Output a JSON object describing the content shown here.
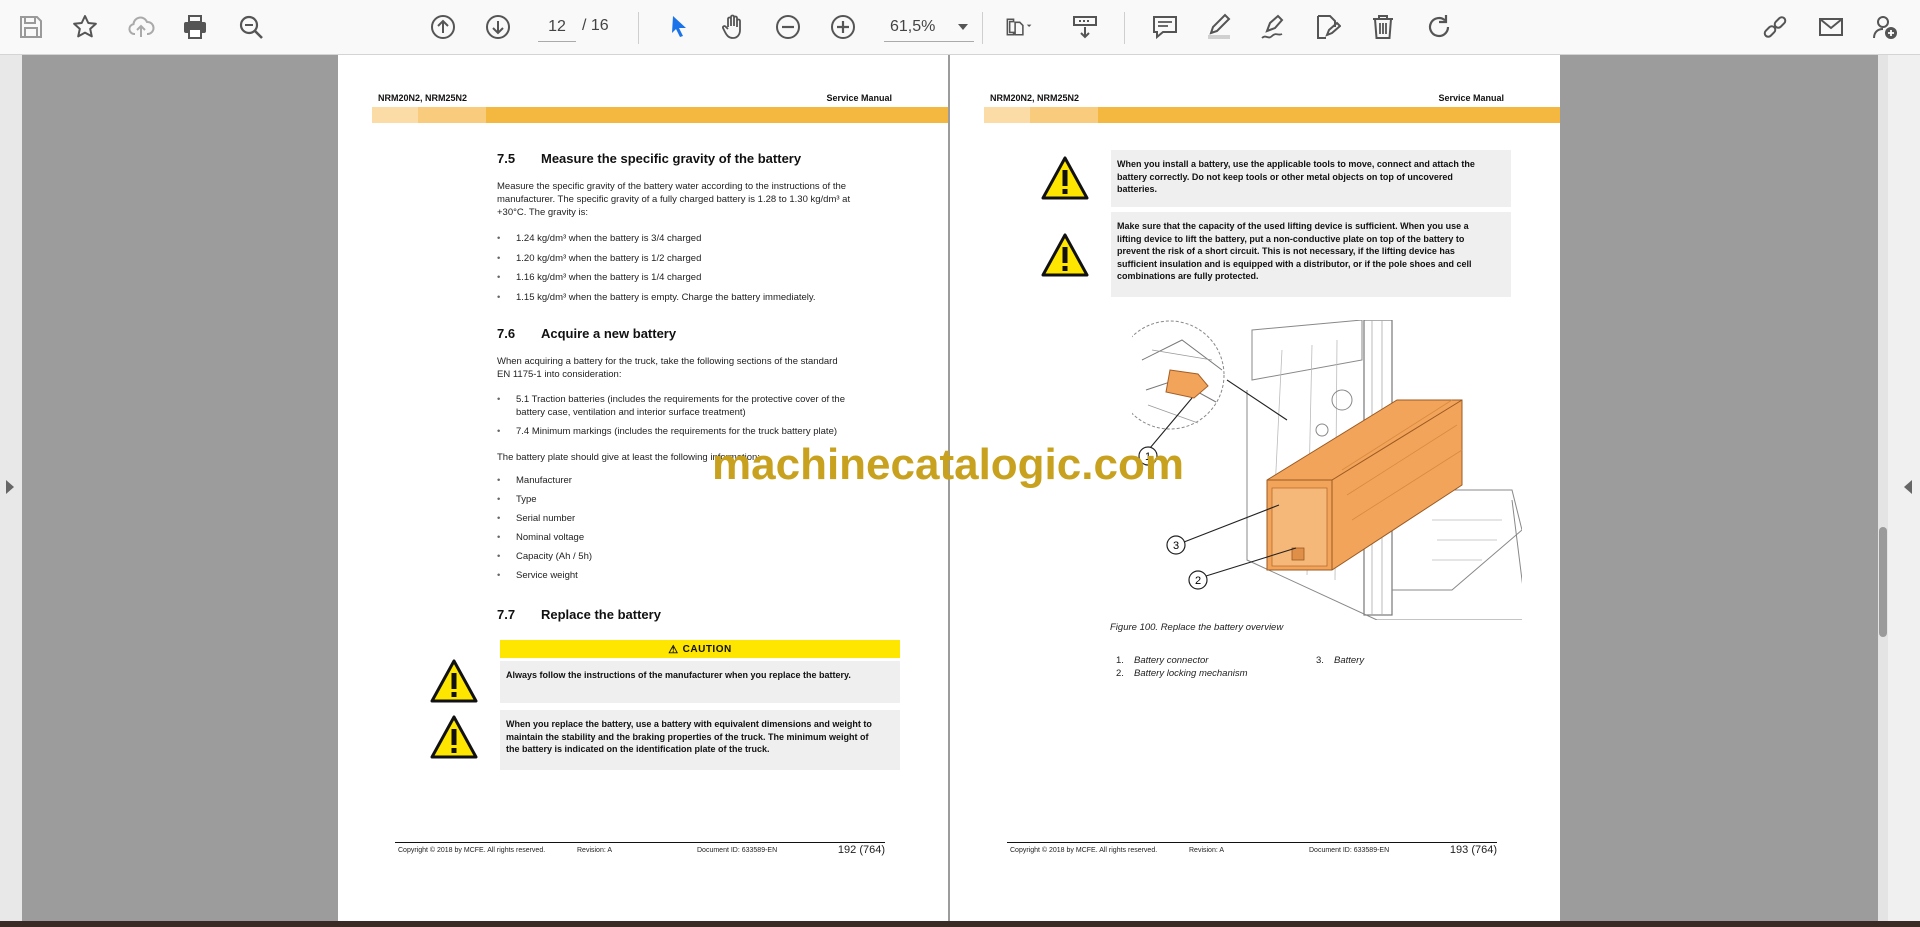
{
  "toolbar": {
    "page_current": "12",
    "page_total": "/ 16",
    "zoom": "61,5%"
  },
  "pages": {
    "left": {
      "header_left": "NRM20N2, NRM25N2",
      "header_right": "Service Manual",
      "sec75_num": "7.5",
      "sec75_title": "Measure the specific gravity of the battery",
      "sec75_para1": "Measure the specific gravity of the battery water according to the instructions of the",
      "sec75_para2": "manufacturer. The specific gravity of a fully charged battery is 1.28 to 1.30 kg/dm³ at",
      "sec75_para3": "+30°C. The gravity is:",
      "sec75_bullets": [
        "1.24 kg/dm³ when the battery is 3/4 charged",
        "1.20 kg/dm³ when the battery is 1/2 charged",
        "1.16 kg/dm³ when the battery is 1/4 charged",
        "1.15 kg/dm³ when the battery is empty. Charge the battery immediately."
      ],
      "sec76_num": "7.6",
      "sec76_title": "Acquire a new battery",
      "sec76_para1": "When acquiring a battery for the truck, take the following sections of the standard",
      "sec76_para2": "EN 1175-1 into consideration:",
      "sec76_bullets_a": "5.1 Traction batteries (includes the requirements for the protective cover of the",
      "sec76_bullets_a2": "battery case, ventilation and interior surface treatment)",
      "sec76_bullets_b": "7.4 Minimum markings (includes the requirements for the truck battery plate)",
      "sec76_para3": "The battery plate should give at least the following information:",
      "plate_items": [
        "Manufacturer",
        "Type",
        "Serial number",
        "Nominal voltage",
        "Capacity (Ah / 5h)",
        "Service weight"
      ],
      "sec77_num": "7.7",
      "sec77_title": "Replace the battery",
      "caution_label": "CAUTION",
      "caution1": "Always follow the instructions of the manufacturer when you replace the battery.",
      "caution2_l1": "When you replace the battery, use a battery with equivalent dimensions and weight to",
      "caution2_l2": "maintain the stability and the braking properties of the truck. The minimum weight of",
      "caution2_l3": "the battery is indicated on the identification plate of the truck.",
      "footer_copyright": "Copyright © 2018 by MCFE. All rights reserved.",
      "footer_revision": "Revision: A",
      "footer_docid": "Document ID: 633589-EN",
      "footer_page": "192 (764)"
    },
    "right": {
      "header_left": "NRM20N2, NRM25N2",
      "header_right": "Service Manual",
      "warn1_l1": "When you install a battery, use the applicable tools to move, connect and attach the",
      "warn1_l2": "battery correctly. Do not keep tools or other metal objects on top of uncovered",
      "warn1_l3": "batteries.",
      "warn2_l1": "Make sure that the capacity of the used lifting device is sufficient. When you use a",
      "warn2_l2": "lifting device to lift the battery, put a non-conductive plate on top of the battery to",
      "warn2_l3": "prevent the risk of a short circuit. This is not necessary, if the lifting device has",
      "warn2_l4": "sufficient insulation and is equipped with a distributor, or if the pole shoes and cell",
      "warn2_l5": "combinations are fully protected.",
      "callouts": [
        "1",
        "2",
        "3"
      ],
      "figure_caption": "Figure 100. Replace the battery overview",
      "legend": [
        {
          "n": "1.",
          "t": "Battery connector"
        },
        {
          "n": "2.",
          "t": "Battery locking mechanism"
        },
        {
          "n": "3.",
          "t": "Battery"
        }
      ],
      "footer_copyright": "Copyright © 2018 by MCFE. All rights reserved.",
      "footer_revision": "Revision: A",
      "footer_docid": "Document ID: 633589-EN",
      "footer_page": "193 (764)"
    }
  },
  "watermark": "machinecatalogic.com",
  "colors": {
    "band": "#f4b740",
    "caution": "#ffe600",
    "battery": "#f2a45a",
    "watermark": "#c8a11e"
  },
  "icons": [
    "save-icon",
    "bookmark-star-icon",
    "cloud-upload-icon",
    "print-icon",
    "zoom-search-icon",
    "page-up-icon",
    "page-down-icon",
    "select-cursor-icon",
    "hand-pan-icon",
    "zoom-out-icon",
    "zoom-in-icon",
    "fit-page-icon",
    "scroll-mode-icon",
    "comment-icon",
    "highlight-pen-icon",
    "draw-pen-icon",
    "sign-icon",
    "delete-icon",
    "rotate-icon",
    "share-link-icon",
    "email-icon",
    "add-user-icon",
    "warning-icon"
  ]
}
